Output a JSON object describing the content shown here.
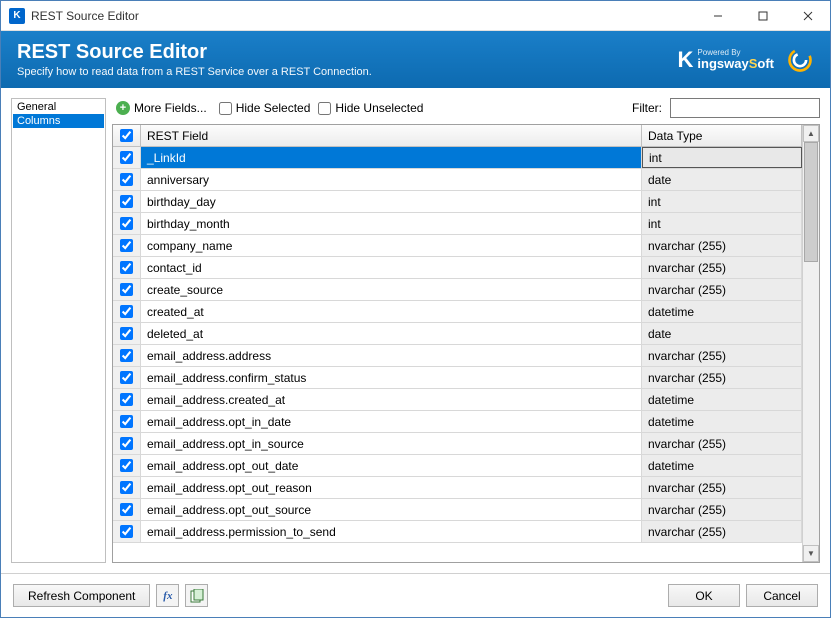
{
  "window": {
    "title": "REST Source Editor",
    "app_icon_letter": "K"
  },
  "banner": {
    "heading": "REST Source Editor",
    "subtitle": "Specify how to read data from a REST Service over a REST Connection.",
    "logo_powered_by": "Powered By",
    "logo_name_1": "ingsway",
    "logo_name_2": "oft",
    "logo_k": "K",
    "logo_s": "S"
  },
  "sidebar": {
    "items": [
      {
        "label": "General",
        "selected": false
      },
      {
        "label": "Columns",
        "selected": true
      }
    ]
  },
  "toolbar": {
    "more_fields": "More Fields...",
    "hide_selected": "Hide Selected",
    "hide_unselected": "Hide Unselected",
    "filter_label": "Filter:",
    "filter_value": ""
  },
  "grid": {
    "headers": {
      "field": "REST Field",
      "dtype": "Data Type"
    },
    "rows": [
      {
        "field": "_LinkId",
        "dtype": "int",
        "checked": true,
        "selected": true
      },
      {
        "field": "anniversary",
        "dtype": "date",
        "checked": true
      },
      {
        "field": "birthday_day",
        "dtype": "int",
        "checked": true
      },
      {
        "field": "birthday_month",
        "dtype": "int",
        "checked": true
      },
      {
        "field": "company_name",
        "dtype": "nvarchar (255)",
        "checked": true
      },
      {
        "field": "contact_id",
        "dtype": "nvarchar (255)",
        "checked": true
      },
      {
        "field": "create_source",
        "dtype": "nvarchar (255)",
        "checked": true
      },
      {
        "field": "created_at",
        "dtype": "datetime",
        "checked": true
      },
      {
        "field": "deleted_at",
        "dtype": "date",
        "checked": true
      },
      {
        "field": "email_address.address",
        "dtype": "nvarchar (255)",
        "checked": true
      },
      {
        "field": "email_address.confirm_status",
        "dtype": "nvarchar (255)",
        "checked": true
      },
      {
        "field": "email_address.created_at",
        "dtype": "datetime",
        "checked": true
      },
      {
        "field": "email_address.opt_in_date",
        "dtype": "datetime",
        "checked": true
      },
      {
        "field": "email_address.opt_in_source",
        "dtype": "nvarchar (255)",
        "checked": true
      },
      {
        "field": "email_address.opt_out_date",
        "dtype": "datetime",
        "checked": true
      },
      {
        "field": "email_address.opt_out_reason",
        "dtype": "nvarchar (255)",
        "checked": true
      },
      {
        "field": "email_address.opt_out_source",
        "dtype": "nvarchar (255)",
        "checked": true
      },
      {
        "field": "email_address.permission_to_send",
        "dtype": "nvarchar (255)",
        "checked": true
      }
    ]
  },
  "footer": {
    "refresh": "Refresh Component",
    "ok": "OK",
    "cancel": "Cancel"
  }
}
